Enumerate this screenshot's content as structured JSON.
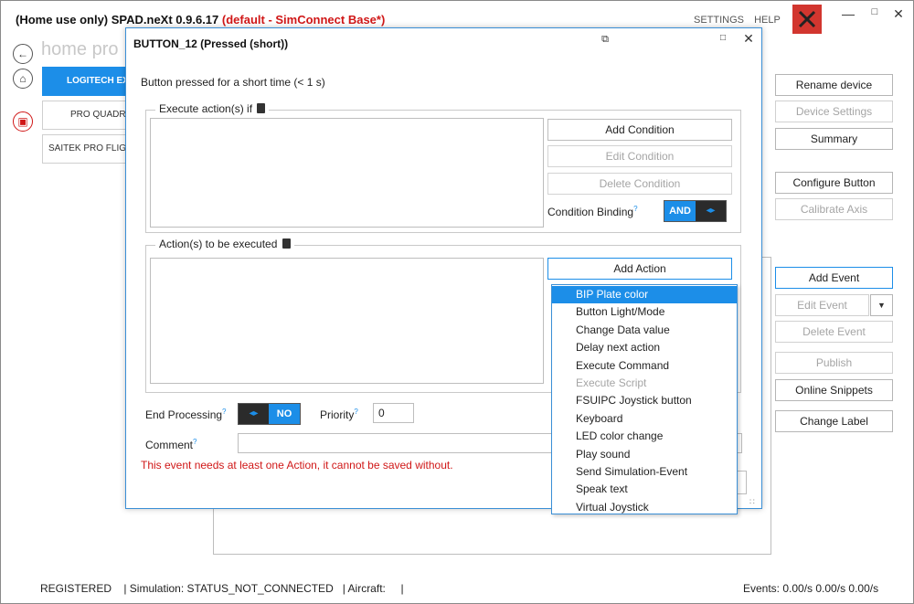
{
  "window": {
    "title_prefix": "(Home use only) SPAD.neXt 0.9.6.17 ",
    "title_suffix": "(default - SimConnect Base*)",
    "links": [
      "SETTINGS",
      "HELP"
    ],
    "min_glyph": "—",
    "max_glyph": "□",
    "close_glyph": "✕"
  },
  "nav": {
    "back_glyph": "←",
    "home_glyph": "⌂",
    "save_glyph": "▣",
    "home_text": "home  pro"
  },
  "devices": [
    "LOGITECH EXT",
    "PRO QUADRA",
    "SAITEK PRO FLIGHT"
  ],
  "side_buttons": {
    "rename": "Rename device",
    "device_settings": "Device Settings",
    "summary": "Summary",
    "configure": "Configure Button",
    "calibrate": "Calibrate Axis",
    "add_event": "Add Event",
    "edit_event": "Edit Event",
    "edit_event_arrow": "▼",
    "delete_event": "Delete Event",
    "publish": "Publish",
    "online_snippets": "Online Snippets",
    "change_label": "Change Label"
  },
  "status": {
    "left": "REGISTERED    | Simulation: STATUS_NOT_CONNECTED   | Aircraft:     |",
    "right": "Events: 0.00/s 0.00/s 0.00/s"
  },
  "dialog": {
    "title": "BUTTON_12 (Pressed (short))",
    "restore_glyph": "⧉",
    "max_glyph": "□",
    "close_glyph": "✕",
    "description": "Button pressed for a short time (< 1 s)",
    "conditions_group": "Execute action(s) if",
    "add_condition": "Add Condition",
    "edit_condition": "Edit Condition",
    "delete_condition": "Delete Condition",
    "condition_binding_label": "Condition Binding",
    "help_mark": "?",
    "arrows": "◂▸",
    "binding_value": "AND",
    "actions_group": "Action(s) to be executed",
    "add_action": "Add Action",
    "end_processing_label": "End Processing",
    "end_processing_value": "NO",
    "priority_label": "Priority",
    "priority_value": "0",
    "comment_label": "Comment",
    "error": "This event needs at least one Action, it cannot be saved without.",
    "grip": "∷"
  },
  "action_menu": [
    {
      "label": "BIP Plate color",
      "state": "selected"
    },
    {
      "label": "Button Light/Mode",
      "state": "normal"
    },
    {
      "label": "Change Data value",
      "state": "normal"
    },
    {
      "label": "Delay next action",
      "state": "normal"
    },
    {
      "label": "Execute Command",
      "state": "normal"
    },
    {
      "label": "Execute Script",
      "state": "disabled"
    },
    {
      "label": "FSUIPC Joystick button",
      "state": "normal"
    },
    {
      "label": "Keyboard",
      "state": "normal"
    },
    {
      "label": "LED color change",
      "state": "normal"
    },
    {
      "label": "Play sound",
      "state": "normal"
    },
    {
      "label": "Send Simulation-Event",
      "state": "normal"
    },
    {
      "label": "Speak text",
      "state": "normal"
    },
    {
      "label": "Virtual Joystick",
      "state": "normal"
    }
  ]
}
